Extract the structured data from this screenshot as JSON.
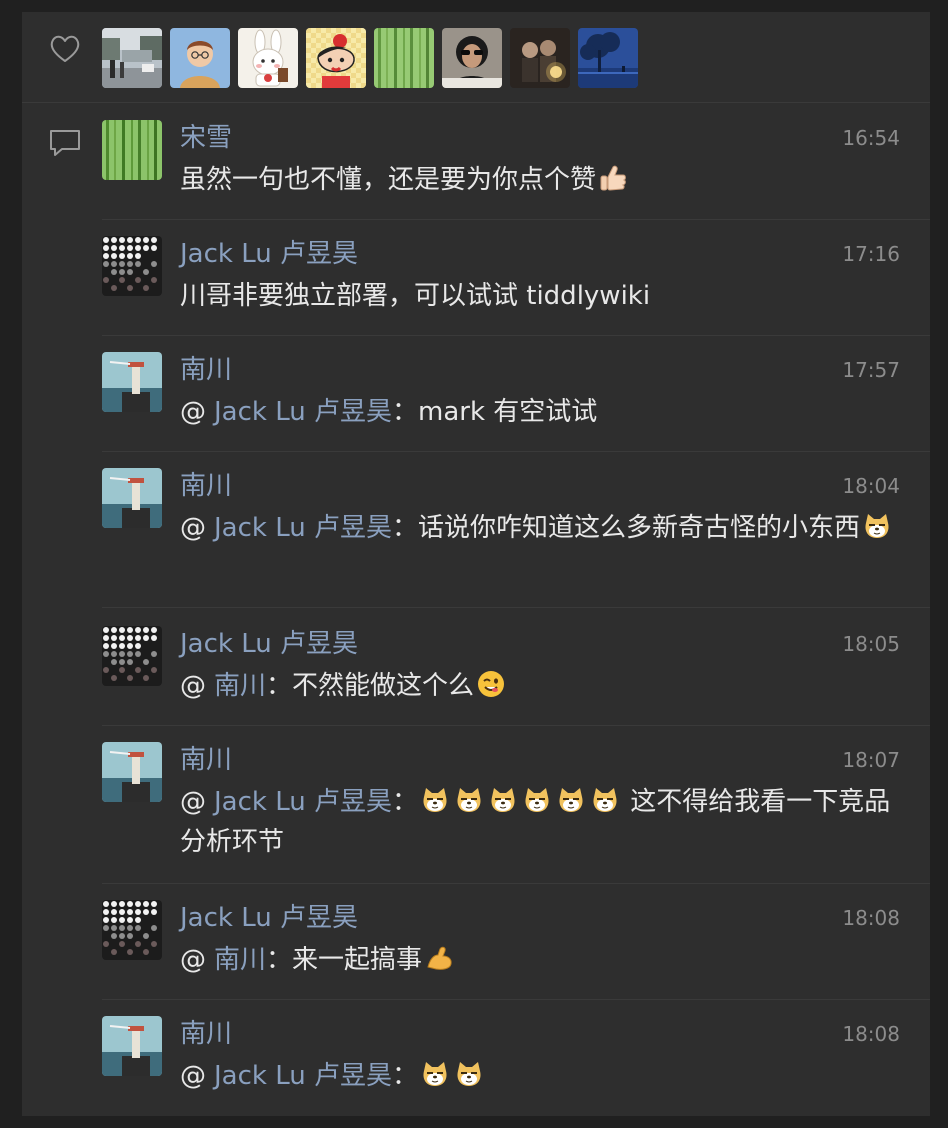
{
  "likes": {
    "avatars": [
      {
        "name": "street-photo"
      },
      {
        "name": "cartoon-man"
      },
      {
        "name": "white-rabbit"
      },
      {
        "name": "crayon-shin-chan"
      },
      {
        "name": "bamboo"
      },
      {
        "name": "sunglasses-person"
      },
      {
        "name": "sparkler-couple"
      },
      {
        "name": "tree-night"
      }
    ]
  },
  "comments": [
    {
      "author": "宋雪",
      "time": "16:54",
      "avatar": "bamboo",
      "text": "虽然一句也不懂，还是要为你点个赞",
      "emoji": [
        "thumbs-up"
      ]
    },
    {
      "author": "Jack Lu 卢昱昊",
      "time": "17:16",
      "avatar": "dot-grid",
      "text": "川哥非要独立部署，可以试试 tiddlywiki"
    },
    {
      "author": "南川",
      "time": "17:57",
      "avatar": "lighthouse",
      "mention": "Jack Lu 卢昱昊",
      "text": "mark 有空试试"
    },
    {
      "author": "南川",
      "time": "18:04",
      "avatar": "lighthouse",
      "mention": "Jack Lu 卢昱昊",
      "text": "话说你咋知道这么多新奇古怪的小东西",
      "emoji": [
        "doge"
      ]
    },
    {
      "author": "Jack Lu 卢昱昊",
      "time": "18:05",
      "avatar": "dot-grid",
      "mention": "南川",
      "text": "不然能做这个么",
      "emoji": [
        "wink"
      ]
    },
    {
      "author": "南川",
      "time": "18:07",
      "avatar": "lighthouse",
      "mention": "Jack Lu 卢昱昊",
      "text": " 这不得给我看一下竞品分析环节",
      "emoji": [
        "doge",
        "doge",
        "doge",
        "doge",
        "doge",
        "doge"
      ]
    },
    {
      "author": "Jack Lu 卢昱昊",
      "time": "18:08",
      "avatar": "dot-grid",
      "mention": "南川",
      "text": "来一起搞事",
      "emoji": [
        "flexed-arm"
      ]
    },
    {
      "author": "南川",
      "time": "18:08",
      "avatar": "lighthouse",
      "mention": "Jack Lu 卢昱昊",
      "text": "",
      "emoji": [
        "doge",
        "doge"
      ]
    }
  ],
  "labels": {
    "at": "@",
    "colon": "："
  }
}
